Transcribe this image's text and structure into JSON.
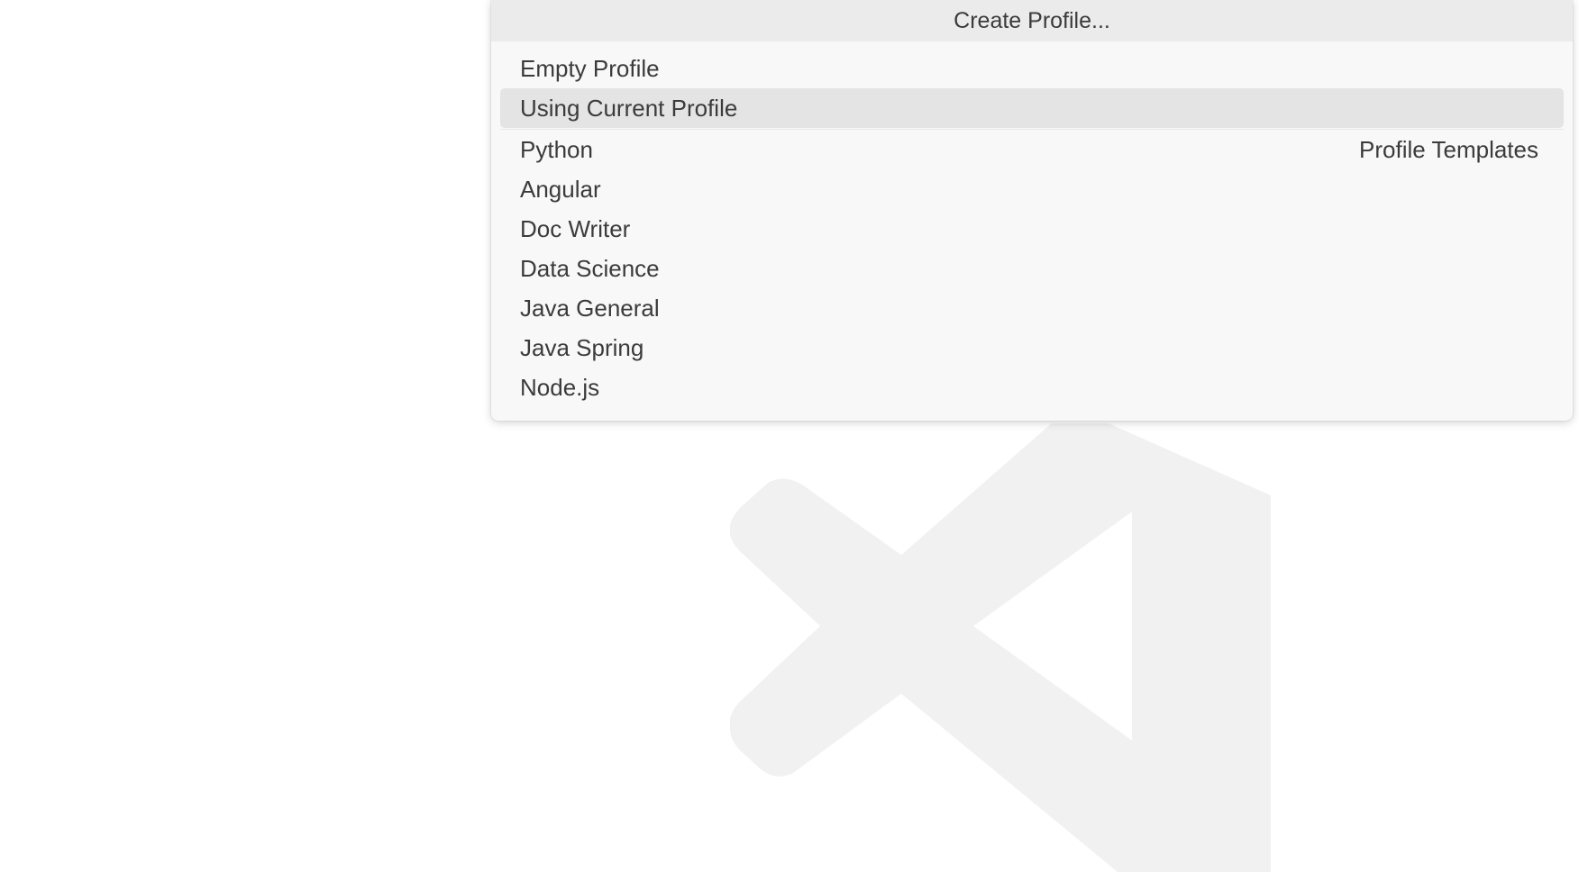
{
  "quick_pick": {
    "title": "Create Profile...",
    "items": [
      {
        "label": "Empty Profile"
      },
      {
        "label": "Using Current Profile"
      },
      {
        "label": "Python"
      },
      {
        "label": "Angular"
      },
      {
        "label": "Doc Writer"
      },
      {
        "label": "Data Science"
      },
      {
        "label": "Java General"
      },
      {
        "label": "Java Spring"
      },
      {
        "label": "Node.js"
      }
    ],
    "selected_index": 1,
    "template_group_label": "Profile Templates"
  },
  "background": {
    "watermark_icon": "vscode-logo-icon"
  },
  "colors": {
    "title_bg": "#ebebeb",
    "list_bg": "#f8f8f8",
    "selected_bg": "#e4e4e4",
    "text": "#3b3b3b",
    "watermark": "#f1f1f1"
  }
}
